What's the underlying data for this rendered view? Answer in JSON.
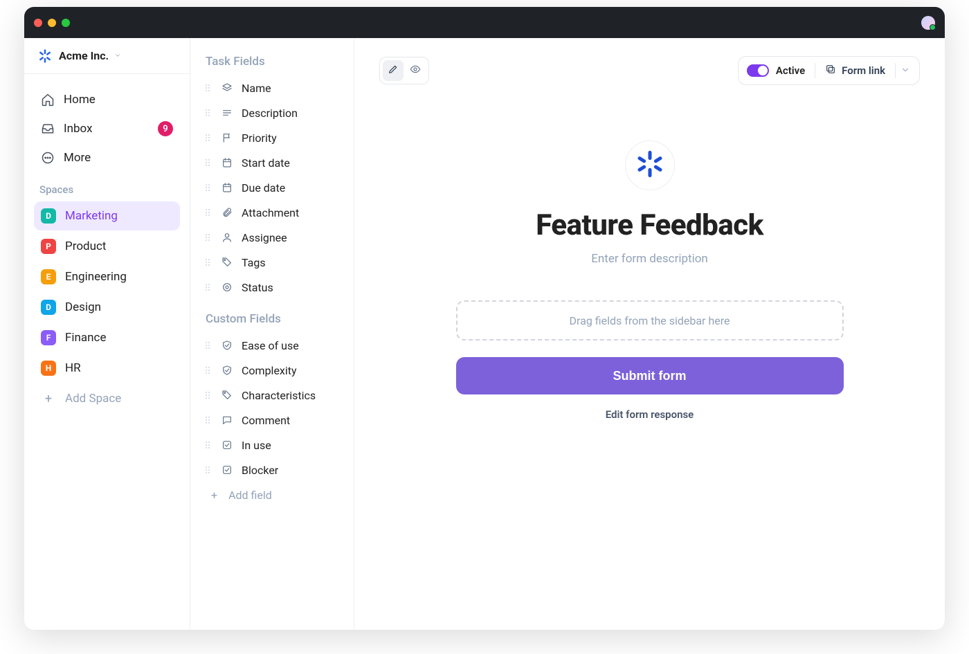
{
  "workspace_name": "Acme Inc.",
  "nav": {
    "home": "Home",
    "inbox": "Inbox",
    "inbox_badge": "9",
    "more": "More"
  },
  "spaces_heading": "Spaces",
  "spaces": [
    {
      "letter": "D",
      "label": "Marketing",
      "color": "#14b8a6",
      "active": true
    },
    {
      "letter": "P",
      "label": "Product",
      "color": "#ef4444",
      "active": false
    },
    {
      "letter": "E",
      "label": "Engineering",
      "color": "#f59e0b",
      "active": false
    },
    {
      "letter": "D",
      "label": "Design",
      "color": "#0ea5e9",
      "active": false
    },
    {
      "letter": "F",
      "label": "Finance",
      "color": "#8b5cf6",
      "active": false
    },
    {
      "letter": "H",
      "label": "HR",
      "color": "#f97316",
      "active": false
    }
  ],
  "add_space": "Add Space",
  "task_fields_heading": "Task Fields",
  "task_fields": [
    {
      "icon": "layers",
      "label": "Name"
    },
    {
      "icon": "lines",
      "label": "Description"
    },
    {
      "icon": "flag",
      "label": "Priority"
    },
    {
      "icon": "calendar",
      "label": "Start date"
    },
    {
      "icon": "calendar",
      "label": "Due date"
    },
    {
      "icon": "clip",
      "label": "Attachment"
    },
    {
      "icon": "user",
      "label": "Assignee"
    },
    {
      "icon": "tag",
      "label": "Tags"
    },
    {
      "icon": "target",
      "label": "Status"
    }
  ],
  "custom_fields_heading": "Custom Fields",
  "custom_fields": [
    {
      "icon": "shield",
      "label": "Ease of use"
    },
    {
      "icon": "shield",
      "label": "Complexity"
    },
    {
      "icon": "tag",
      "label": "Characteristics"
    },
    {
      "icon": "comment",
      "label": "Comment"
    },
    {
      "icon": "check",
      "label": "In use"
    },
    {
      "icon": "check",
      "label": "Blocker"
    }
  ],
  "add_field": "Add field",
  "top": {
    "active_label": "Active",
    "form_link_label": "Form link"
  },
  "form": {
    "title": "Feature Feedback",
    "description_placeholder": "Enter form description",
    "dropzone_hint": "Drag fields from the sidebar here",
    "submit_label": "Submit form",
    "edit_response_label": "Edit form response"
  },
  "colors": {
    "accent": "#7c3aed",
    "accent_button": "#7c61db",
    "badge": "#e11d68"
  }
}
